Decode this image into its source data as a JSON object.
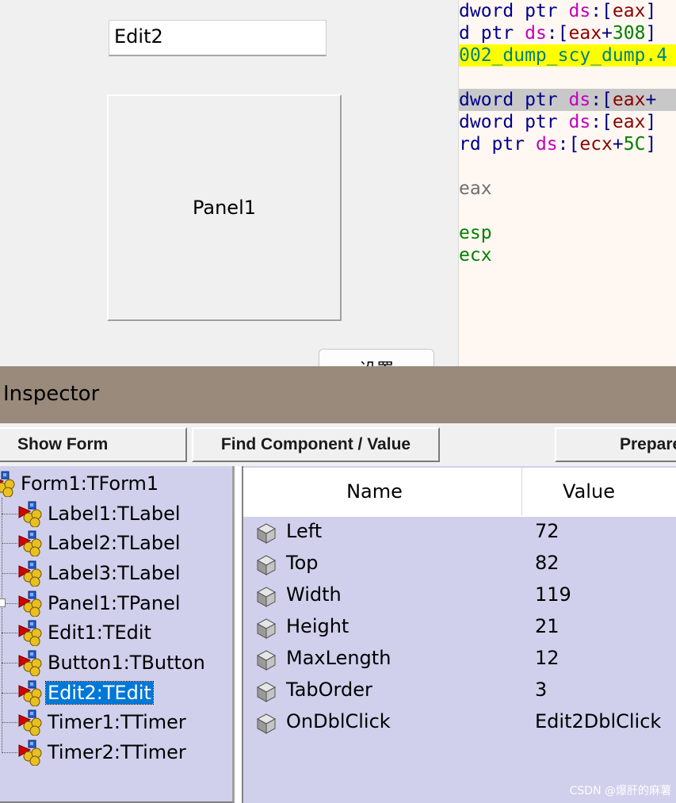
{
  "form_designer": {
    "edit2_text": "Edit2",
    "panel1_caption": "Panel1",
    "button1_caption_partial": "设置"
  },
  "disassembly": {
    "lines": [
      {
        "parts": [
          [
            "kw",
            "dword ptr "
          ],
          [
            "seg",
            "ds"
          ],
          [
            "punc",
            ":["
          ],
          [
            "reg",
            "eax"
          ],
          [
            "punc",
            "]"
          ]
        ]
      },
      {
        "parts": [
          [
            "kw",
            "d ptr "
          ],
          [
            "seg",
            "ds"
          ],
          [
            "punc",
            ":["
          ],
          [
            "reg",
            "eax"
          ],
          [
            "punc",
            "+"
          ],
          [
            "num",
            "308"
          ],
          [
            "punc",
            "]"
          ]
        ]
      },
      {
        "parts": [
          [
            "hl-yellow",
            "002_dump_scy_dump.4"
          ]
        ]
      },
      {
        "parts": []
      },
      {
        "parts": [
          [
            "kw",
            "dword ptr "
          ],
          [
            "seg",
            "ds"
          ],
          [
            "punc",
            ":["
          ],
          [
            "reg",
            "eax"
          ],
          [
            "punc",
            "+"
          ]
        ],
        "highlight": "gray"
      },
      {
        "parts": [
          [
            "kw",
            "dword ptr "
          ],
          [
            "seg",
            "ds"
          ],
          [
            "punc",
            ":["
          ],
          [
            "reg",
            "eax"
          ],
          [
            "punc",
            "]"
          ]
        ]
      },
      {
        "parts": [
          [
            "kw",
            "rd ptr "
          ],
          [
            "seg",
            "ds"
          ],
          [
            "punc",
            ":["
          ],
          [
            "reg",
            "ecx"
          ],
          [
            "punc",
            "+"
          ],
          [
            "num",
            "5C"
          ],
          [
            "punc",
            "]"
          ]
        ]
      },
      {
        "parts": []
      },
      {
        "parts": [
          [
            "gry",
            "eax"
          ]
        ]
      },
      {
        "parts": []
      },
      {
        "parts": [
          [
            "grn",
            "esp"
          ]
        ]
      },
      {
        "parts": [
          [
            "grn",
            "ecx"
          ]
        ]
      }
    ]
  },
  "inspector": {
    "title": "Inspector",
    "toolbar": {
      "show_form": "Show Form",
      "find_component": "Find Component / Value",
      "prepare": "Prepare"
    },
    "tree": {
      "root": "Form1:TForm1",
      "children": [
        "Label1:TLabel",
        "Label2:TLabel",
        "Label3:TLabel",
        "Panel1:TPanel",
        "Edit1:TEdit",
        "Button1:TButton",
        "Edit2:TEdit",
        "Timer1:TTimer",
        "Timer2:TTimer"
      ],
      "selected": "Edit2:TEdit",
      "expandable": "Panel1:TPanel"
    },
    "properties": {
      "header_name": "Name",
      "header_value": "Value",
      "rows": [
        {
          "name": "Left",
          "value": "72"
        },
        {
          "name": "Top",
          "value": "82"
        },
        {
          "name": "Width",
          "value": "119"
        },
        {
          "name": "Height",
          "value": "21"
        },
        {
          "name": "MaxLength",
          "value": "12"
        },
        {
          "name": "TabOrder",
          "value": "3"
        },
        {
          "name": "OnDblClick",
          "value": "Edit2DblClick"
        }
      ]
    }
  },
  "watermark": "CSDN @爆肝的麻薯",
  "colors": {
    "inspector_title_bar": "#998a7b",
    "tree_background": "#d0d0ec",
    "selection": "#0078d7",
    "code_background": "#fff8f2",
    "code_highlight_yellow": "#ffff00"
  },
  "icons": {
    "component": "component-icon",
    "property": "property-cube-icon"
  }
}
